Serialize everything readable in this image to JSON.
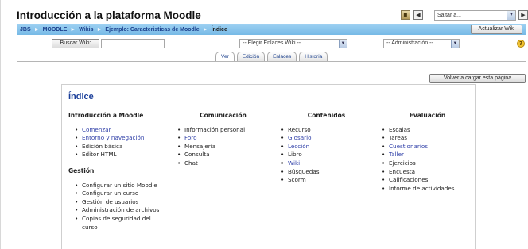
{
  "header": {
    "site_title": "Introducción a la plataforma Moodle",
    "jump_placeholder": "Saltar a..."
  },
  "navbar": {
    "crumbs": [
      "JBS",
      "MOODLE",
      "Wikis",
      "Ejemplo: Caracteristicas de Moodle"
    ],
    "current": "Índice",
    "separator": "►",
    "update_button": "Actualizar Wiki"
  },
  "toolbar": {
    "search_button": "Buscar Wiki:",
    "search_value": "",
    "links_select": "-- Elegir Enlaces Wiki --",
    "admin_select": "-- Administración --"
  },
  "tabs": [
    {
      "label": "Ver",
      "active": true
    },
    {
      "label": "Edición",
      "active": false
    },
    {
      "label": "Enlaces",
      "active": false
    },
    {
      "label": "Historia",
      "active": false
    }
  ],
  "reload_button": "Volver a cargar esta página",
  "content": {
    "title": "Índice",
    "columns": [
      {
        "heading": "Introducción a Moodle",
        "items": [
          {
            "label": "Comenzar",
            "link": true
          },
          {
            "label": "Entorno y navegación",
            "link": true
          },
          {
            "label": "Edición básica",
            "link": false
          },
          {
            "label": "Editor HTML",
            "link": false
          }
        ],
        "subheading": "Gestión",
        "subitems": [
          {
            "label": "Configurar un sitio Moodle",
            "link": false
          },
          {
            "label": "Configurar un curso",
            "link": false
          },
          {
            "label": "Gestión de usuarios",
            "link": false
          },
          {
            "label": "Administración de archivos",
            "link": false
          },
          {
            "label": "Copias de seguridad del",
            "link": false
          },
          {
            "label": "curso",
            "link": false
          }
        ]
      },
      {
        "heading": "Comunicación",
        "items": [
          {
            "label": "Información personal",
            "link": false
          },
          {
            "label": "Foro",
            "link": true
          },
          {
            "label": "Mensajería",
            "link": false
          },
          {
            "label": "Consulta",
            "link": false
          },
          {
            "label": "Chat",
            "link": false
          }
        ]
      },
      {
        "heading": "Contenidos",
        "items": [
          {
            "label": "Recurso",
            "link": false
          },
          {
            "label": "Glosario",
            "link": true
          },
          {
            "label": "Lección",
            "link": true
          },
          {
            "label": "Libro",
            "link": false
          },
          {
            "label": "Wiki",
            "link": true
          },
          {
            "label": "Búsquedas",
            "link": false
          },
          {
            "label": "Scorm",
            "link": false
          }
        ]
      },
      {
        "heading": "Evaluación",
        "items": [
          {
            "label": "Escalas",
            "link": false
          },
          {
            "label": "Tareas",
            "link": false
          },
          {
            "label": "Cuestionarios",
            "link": true
          },
          {
            "label": "Taller",
            "link": true
          },
          {
            "label": "Ejercicios",
            "link": false
          },
          {
            "label": "Encuesta",
            "link": false
          },
          {
            "label": "Calificaciones",
            "link": false
          },
          {
            "label": "Informe de actividades",
            "link": false
          }
        ]
      }
    ]
  },
  "colors": {
    "navbar_top": "#9ed1f2",
    "navbar_bottom": "#76b9e6",
    "link": "#3040a8",
    "title": "#1b3f9a"
  }
}
